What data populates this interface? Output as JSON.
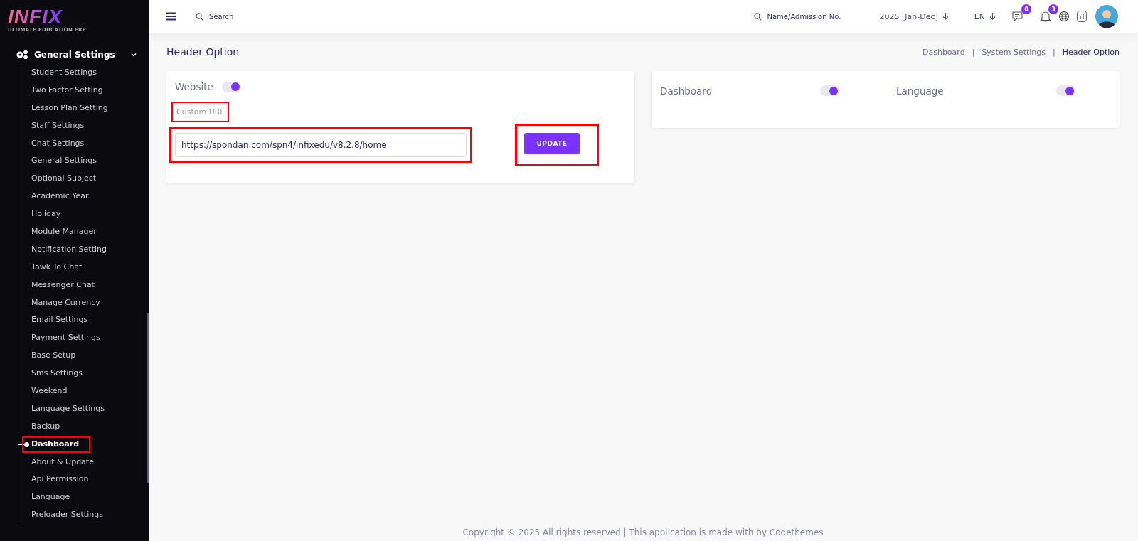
{
  "sidebar": {
    "logo": "INFIX",
    "tagline": "ULTIMATE EDUCATION ERP",
    "section": {
      "label": "General Settings",
      "expanded": true
    },
    "items": [
      {
        "label": "Student Settings",
        "selected": false,
        "highlighted": false
      },
      {
        "label": "Two Factor Setting",
        "selected": false,
        "highlighted": false
      },
      {
        "label": "Lesson Plan Setting",
        "selected": false,
        "highlighted": false
      },
      {
        "label": "Staff Settings",
        "selected": false,
        "highlighted": false
      },
      {
        "label": "Chat Settings",
        "selected": false,
        "highlighted": false
      },
      {
        "label": "General Settings",
        "selected": false,
        "highlighted": false
      },
      {
        "label": "Optional Subject",
        "selected": false,
        "highlighted": false
      },
      {
        "label": "Academic Year",
        "selected": false,
        "highlighted": false
      },
      {
        "label": "Holiday",
        "selected": false,
        "highlighted": false
      },
      {
        "label": "Module Manager",
        "selected": false,
        "highlighted": false
      },
      {
        "label": "Notification Setting",
        "selected": false,
        "highlighted": false
      },
      {
        "label": "Tawk To Chat",
        "selected": false,
        "highlighted": false
      },
      {
        "label": "Messenger Chat",
        "selected": false,
        "highlighted": false
      },
      {
        "label": "Manage Currency",
        "selected": false,
        "highlighted": false
      },
      {
        "label": "Email Settings",
        "selected": false,
        "highlighted": false
      },
      {
        "label": "Payment Settings",
        "selected": false,
        "highlighted": false
      },
      {
        "label": "Base Setup",
        "selected": false,
        "highlighted": false
      },
      {
        "label": "Sms Settings",
        "selected": false,
        "highlighted": false
      },
      {
        "label": "Weekend",
        "selected": false,
        "highlighted": false
      },
      {
        "label": "Language Settings",
        "selected": false,
        "highlighted": false
      },
      {
        "label": "Backup",
        "selected": false,
        "highlighted": false
      },
      {
        "label": "Dashboard",
        "selected": true,
        "highlighted": true
      },
      {
        "label": "About & Update",
        "selected": false,
        "highlighted": false
      },
      {
        "label": "Api Permission",
        "selected": false,
        "highlighted": false
      },
      {
        "label": "Language",
        "selected": false,
        "highlighted": false
      },
      {
        "label": "Preloader Settings",
        "selected": false,
        "highlighted": false
      }
    ]
  },
  "topbar": {
    "search": {
      "placeholder": "Search"
    },
    "student_search": {
      "placeholder": "Name/Admission No."
    },
    "session": "2025 [Jan-Dec]",
    "language": "EN",
    "messages_badge": "0",
    "notifications_badge": "3"
  },
  "page": {
    "title": "Header Option",
    "breadcrumb": [
      {
        "label": "Dashboard",
        "selected": false
      },
      {
        "separator": "|",
        "label": "System Settings",
        "selected": false
      },
      {
        "separator": "|",
        "label": "Header Option",
        "selected": true
      }
    ]
  },
  "website_card": {
    "label": "Website",
    "on": true,
    "url_label": "Custom URL",
    "url_label_highlighted": true,
    "url": "https://spondan.com/spn4/infixedu/v8.2.8/home",
    "url_highlighted": true,
    "button": "UPDATE",
    "button_highlighted": true
  },
  "options": [
    {
      "label": "Dashboard",
      "on": true
    },
    {
      "label": "Language",
      "on": true
    }
  ],
  "footer": "Copyright © 2025 All rights reserved | This application is made with by Codethemes"
}
